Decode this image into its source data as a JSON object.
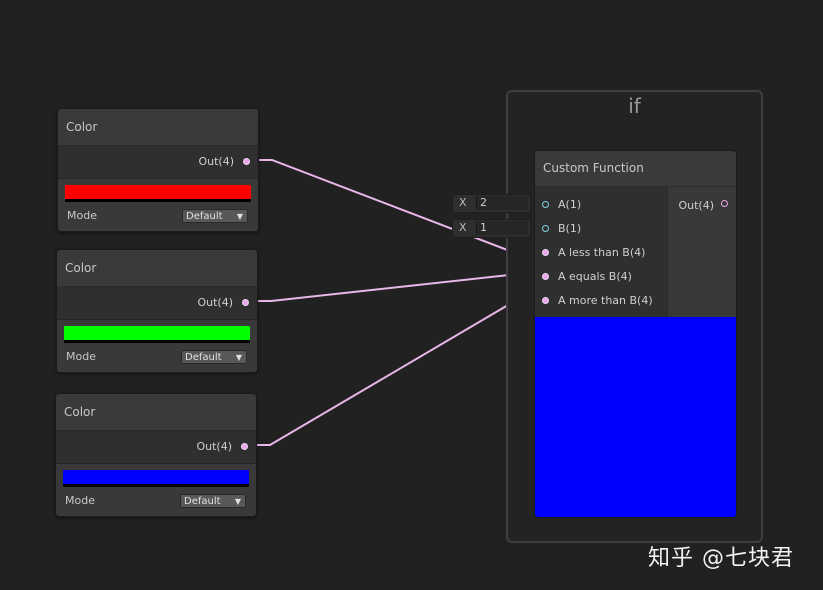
{
  "color_nodes": [
    {
      "title": "Color",
      "output_label": "Out(4)",
      "swatch_color": "#ff0000",
      "mode_label": "Mode",
      "mode_value": "Default"
    },
    {
      "title": "Color",
      "output_label": "Out(4)",
      "swatch_color": "#00ff00",
      "mode_label": "Mode",
      "mode_value": "Default"
    },
    {
      "title": "Color",
      "output_label": "Out(4)",
      "swatch_color": "#0000ff",
      "mode_label": "Mode",
      "mode_value": "Default"
    }
  ],
  "group": {
    "title": "if"
  },
  "custom_function": {
    "title": "Custom Function",
    "inputs": [
      "A(1)",
      "B(1)",
      "A less than B(4)",
      "A equals B(4)",
      "A more than B(4)"
    ],
    "output_label": "Out(4)",
    "preview_color": "#0000ff"
  },
  "inline_fields": [
    {
      "axis": "X",
      "value": "2"
    },
    {
      "axis": "X",
      "value": "1"
    }
  ],
  "wire_colors": {
    "color": "#e8b6e8",
    "float": "#7fd6e6"
  },
  "watermark": "知乎 @七块君"
}
